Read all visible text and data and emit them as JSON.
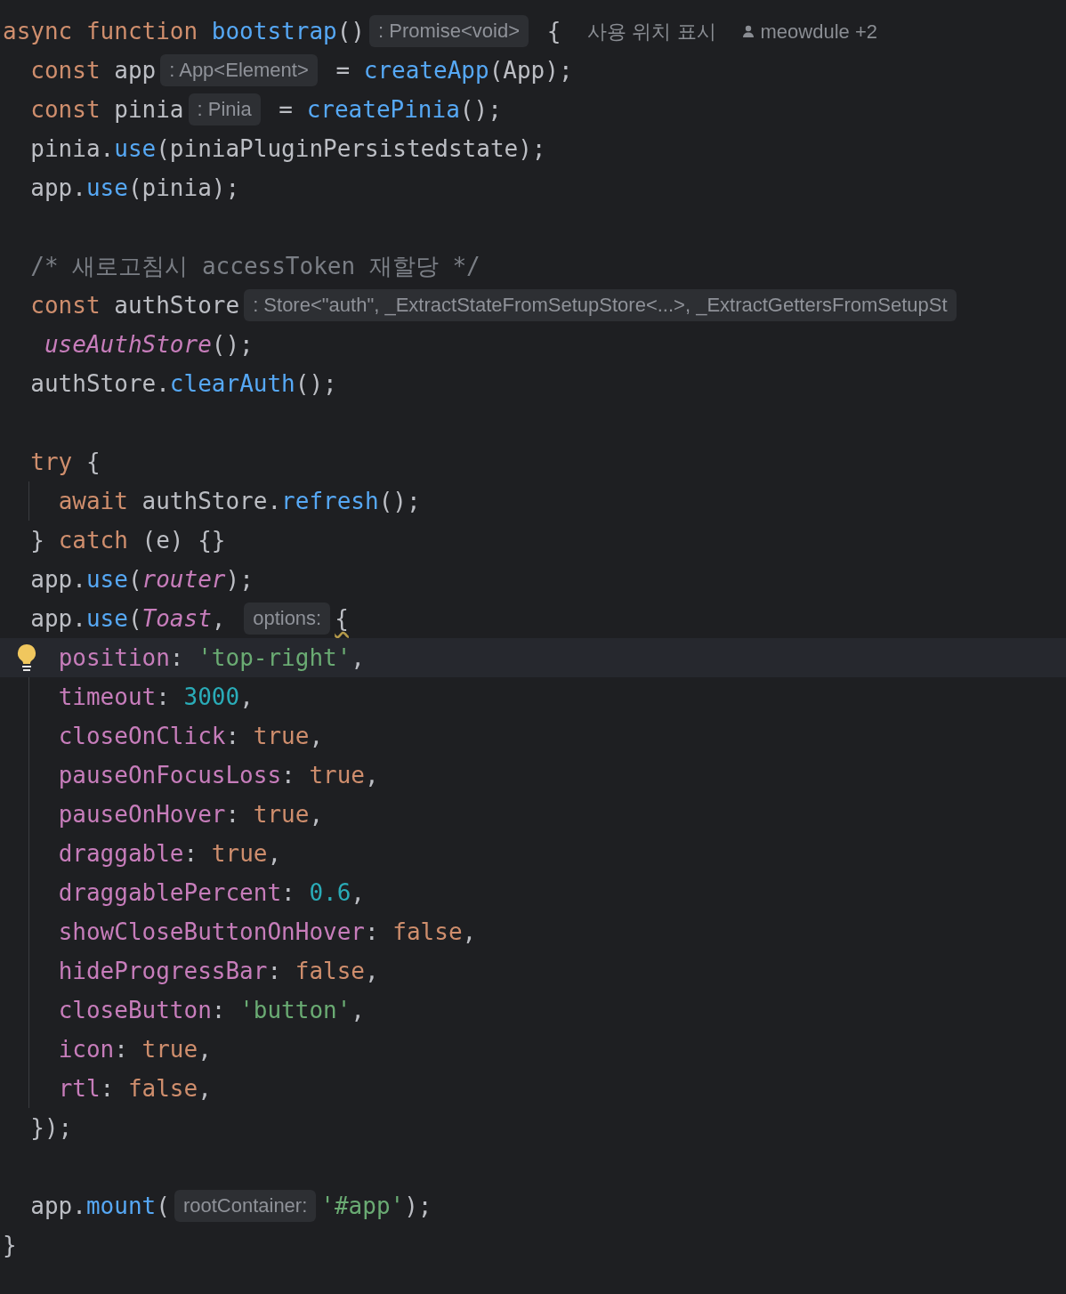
{
  "editor": {
    "lines": [
      {
        "current": false,
        "guide": false,
        "tokens": [
          {
            "kind": "keyword",
            "text": "async function "
          },
          {
            "kind": "fn",
            "text": "bootstrap"
          },
          {
            "kind": "plain",
            "text": "()"
          },
          {
            "kind": "hint",
            "text": ": Promise<void>"
          },
          {
            "kind": "plain",
            "text": " {"
          },
          {
            "kind": "usages",
            "text": "사용 위치 표시"
          },
          {
            "kind": "author",
            "text": "meowdule +2"
          }
        ]
      },
      {
        "current": false,
        "guide": false,
        "tokens": [
          {
            "kind": "keyword",
            "text": "  const "
          },
          {
            "kind": "plain",
            "text": "app"
          },
          {
            "kind": "hint",
            "text": ": App<Element>"
          },
          {
            "kind": "plain",
            "text": " = "
          },
          {
            "kind": "fn",
            "text": "createApp"
          },
          {
            "kind": "plain",
            "text": "(App);"
          }
        ]
      },
      {
        "current": false,
        "guide": false,
        "tokens": [
          {
            "kind": "keyword",
            "text": "  const "
          },
          {
            "kind": "plain",
            "text": "pinia"
          },
          {
            "kind": "hint",
            "text": ": Pinia"
          },
          {
            "kind": "plain",
            "text": " = "
          },
          {
            "kind": "fn",
            "text": "createPinia"
          },
          {
            "kind": "plain",
            "text": "();"
          }
        ]
      },
      {
        "current": false,
        "guide": false,
        "tokens": [
          {
            "kind": "plain",
            "text": "  pinia."
          },
          {
            "kind": "fn",
            "text": "use"
          },
          {
            "kind": "plain",
            "text": "(piniaPluginPersistedstate);"
          }
        ]
      },
      {
        "current": false,
        "guide": false,
        "tokens": [
          {
            "kind": "plain",
            "text": "  app."
          },
          {
            "kind": "fn",
            "text": "use"
          },
          {
            "kind": "plain",
            "text": "(pinia);"
          }
        ]
      },
      {
        "current": false,
        "guide": false
      },
      {
        "current": false,
        "guide": false,
        "tokens": [
          {
            "kind": "comment",
            "text": "  /* 새로고침시 accessToken 재할당 */"
          }
        ]
      },
      {
        "current": false,
        "guide": false,
        "tokens": [
          {
            "kind": "keyword",
            "text": "  const "
          },
          {
            "kind": "plain",
            "text": "authStore"
          },
          {
            "kind": "hint",
            "text": ": Store<\"auth\", _ExtractStateFromSetupStore<...>, _ExtractGettersFromSetupSt"
          }
        ]
      },
      {
        "current": false,
        "guide": false,
        "tokens": [
          {
            "kind": "ident",
            "text": "   useAuthStore"
          },
          {
            "kind": "plain",
            "text": "();"
          }
        ]
      },
      {
        "current": false,
        "guide": false,
        "tokens": [
          {
            "kind": "plain",
            "text": "  authStore."
          },
          {
            "kind": "fn",
            "text": "clearAuth"
          },
          {
            "kind": "plain",
            "text": "();"
          }
        ]
      },
      {
        "current": false,
        "guide": false
      },
      {
        "current": false,
        "guide": false,
        "tokens": [
          {
            "kind": "keyword",
            "text": "  try"
          },
          {
            "kind": "plain",
            "text": " {"
          }
        ]
      },
      {
        "current": false,
        "guide": true,
        "tokens": [
          {
            "kind": "keyword",
            "text": "    await "
          },
          {
            "kind": "plain",
            "text": "authStore."
          },
          {
            "kind": "fn",
            "text": "refresh"
          },
          {
            "kind": "plain",
            "text": "();"
          }
        ]
      },
      {
        "current": false,
        "guide": false,
        "tokens": [
          {
            "kind": "plain",
            "text": "  } "
          },
          {
            "kind": "keyword",
            "text": "catch"
          },
          {
            "kind": "plain",
            "text": " (e) {}"
          }
        ]
      },
      {
        "current": false,
        "guide": false,
        "tokens": [
          {
            "kind": "plain",
            "text": "  app."
          },
          {
            "kind": "fn",
            "text": "use"
          },
          {
            "kind": "plain",
            "text": "("
          },
          {
            "kind": "ident",
            "text": "router"
          },
          {
            "kind": "plain",
            "text": ");"
          }
        ]
      },
      {
        "current": false,
        "guide": false,
        "tokens": [
          {
            "kind": "plain",
            "text": "  app."
          },
          {
            "kind": "fn",
            "text": "use"
          },
          {
            "kind": "plain",
            "text": "("
          },
          {
            "kind": "ident",
            "text": "Toast"
          },
          {
            "kind": "plain",
            "text": ", "
          },
          {
            "kind": "hint",
            "text": "options:"
          },
          {
            "kind": "warning",
            "text": "{"
          }
        ]
      },
      {
        "current": true,
        "guide": true,
        "tokens": [
          {
            "kind": "prop",
            "text": "    position"
          },
          {
            "kind": "plain",
            "text": ": "
          },
          {
            "kind": "str",
            "text": "'top-right'"
          },
          {
            "kind": "plain",
            "text": ","
          }
        ]
      },
      {
        "current": false,
        "guide": true,
        "tokens": [
          {
            "kind": "prop",
            "text": "    timeout"
          },
          {
            "kind": "plain",
            "text": ": "
          },
          {
            "kind": "num",
            "text": "3000"
          },
          {
            "kind": "plain",
            "text": ","
          }
        ]
      },
      {
        "current": false,
        "guide": true,
        "tokens": [
          {
            "kind": "prop",
            "text": "    closeOnClick"
          },
          {
            "kind": "plain",
            "text": ": "
          },
          {
            "kind": "keyword",
            "text": "true"
          },
          {
            "kind": "plain",
            "text": ","
          }
        ]
      },
      {
        "current": false,
        "guide": true,
        "tokens": [
          {
            "kind": "prop",
            "text": "    pauseOnFocusLoss"
          },
          {
            "kind": "plain",
            "text": ": "
          },
          {
            "kind": "keyword",
            "text": "true"
          },
          {
            "kind": "plain",
            "text": ","
          }
        ]
      },
      {
        "current": false,
        "guide": true,
        "tokens": [
          {
            "kind": "prop",
            "text": "    pauseOnHover"
          },
          {
            "kind": "plain",
            "text": ": "
          },
          {
            "kind": "keyword",
            "text": "true"
          },
          {
            "kind": "plain",
            "text": ","
          }
        ]
      },
      {
        "current": false,
        "guide": true,
        "tokens": [
          {
            "kind": "prop",
            "text": "    draggable"
          },
          {
            "kind": "plain",
            "text": ": "
          },
          {
            "kind": "keyword",
            "text": "true"
          },
          {
            "kind": "plain",
            "text": ","
          }
        ]
      },
      {
        "current": false,
        "guide": true,
        "tokens": [
          {
            "kind": "prop",
            "text": "    draggablePercent"
          },
          {
            "kind": "plain",
            "text": ": "
          },
          {
            "kind": "num",
            "text": "0.6"
          },
          {
            "kind": "plain",
            "text": ","
          }
        ]
      },
      {
        "current": false,
        "guide": true,
        "tokens": [
          {
            "kind": "prop",
            "text": "    showCloseButtonOnHover"
          },
          {
            "kind": "plain",
            "text": ": "
          },
          {
            "kind": "keyword",
            "text": "false"
          },
          {
            "kind": "plain",
            "text": ","
          }
        ]
      },
      {
        "current": false,
        "guide": true,
        "tokens": [
          {
            "kind": "prop",
            "text": "    hideProgressBar"
          },
          {
            "kind": "plain",
            "text": ": "
          },
          {
            "kind": "keyword",
            "text": "false"
          },
          {
            "kind": "plain",
            "text": ","
          }
        ]
      },
      {
        "current": false,
        "guide": true,
        "tokens": [
          {
            "kind": "prop",
            "text": "    closeButton"
          },
          {
            "kind": "plain",
            "text": ": "
          },
          {
            "kind": "str",
            "text": "'button'"
          },
          {
            "kind": "plain",
            "text": ","
          }
        ]
      },
      {
        "current": false,
        "guide": true,
        "tokens": [
          {
            "kind": "prop",
            "text": "    icon"
          },
          {
            "kind": "plain",
            "text": ": "
          },
          {
            "kind": "keyword",
            "text": "true"
          },
          {
            "kind": "plain",
            "text": ","
          }
        ]
      },
      {
        "current": false,
        "guide": true,
        "tokens": [
          {
            "kind": "prop",
            "text": "    rtl"
          },
          {
            "kind": "plain",
            "text": ": "
          },
          {
            "kind": "keyword",
            "text": "false"
          },
          {
            "kind": "plain",
            "text": ","
          }
        ]
      },
      {
        "current": false,
        "guide": false,
        "tokens": [
          {
            "kind": "plain",
            "text": "  });"
          }
        ]
      },
      {
        "current": false,
        "guide": false
      },
      {
        "current": false,
        "guide": false,
        "tokens": [
          {
            "kind": "plain",
            "text": "  app."
          },
          {
            "kind": "fn",
            "text": "mount"
          },
          {
            "kind": "plain",
            "text": "("
          },
          {
            "kind": "hint",
            "text": "rootContainer:"
          },
          {
            "kind": "str",
            "text": "'#app'"
          },
          {
            "kind": "plain",
            "text": ");"
          }
        ]
      },
      {
        "current": false,
        "guide": false,
        "tokens": [
          {
            "kind": "plain",
            "text": "}"
          }
        ]
      }
    ]
  }
}
